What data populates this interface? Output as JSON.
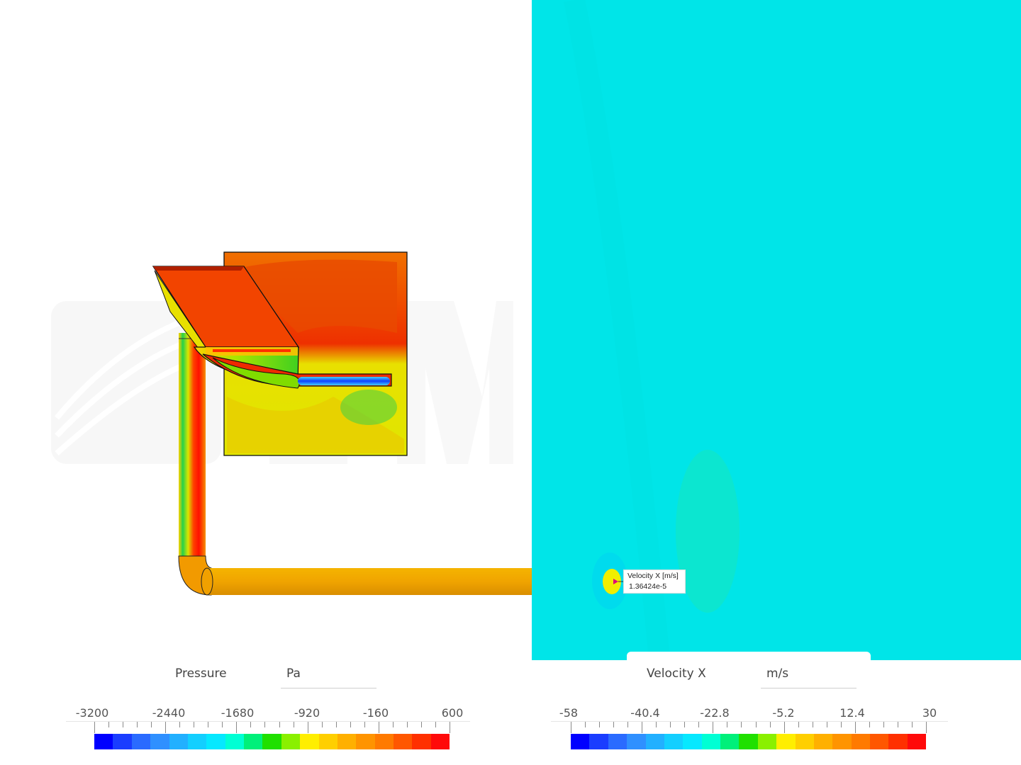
{
  "left_view": {
    "legend": {
      "title": "Pressure",
      "unit": "Pa",
      "ticks": [
        "-3200",
        "-2440",
        "-1680",
        "-920",
        "-160",
        "600"
      ]
    }
  },
  "right_view": {
    "field_color": "#00e5e8",
    "probe": {
      "label": "Velocity X [m/s]",
      "value": "1.36424e-5"
    },
    "legend": {
      "title": "Velocity X",
      "unit": "m/s",
      "ticks": [
        "-58",
        "-40.4",
        "-22.8",
        "-5.2",
        "12.4",
        "30"
      ]
    }
  },
  "colormap": [
    "#0000ff",
    "#1a3dff",
    "#2a6bff",
    "#2f90ff",
    "#22b0ff",
    "#13cfff",
    "#06e8ff",
    "#00ffd4",
    "#00f07a",
    "#20e000",
    "#8af000",
    "#ffee00",
    "#ffcf00",
    "#ffb000",
    "#ff9400",
    "#ff7a00",
    "#ff5700",
    "#ff3000",
    "#ff0a0a"
  ]
}
